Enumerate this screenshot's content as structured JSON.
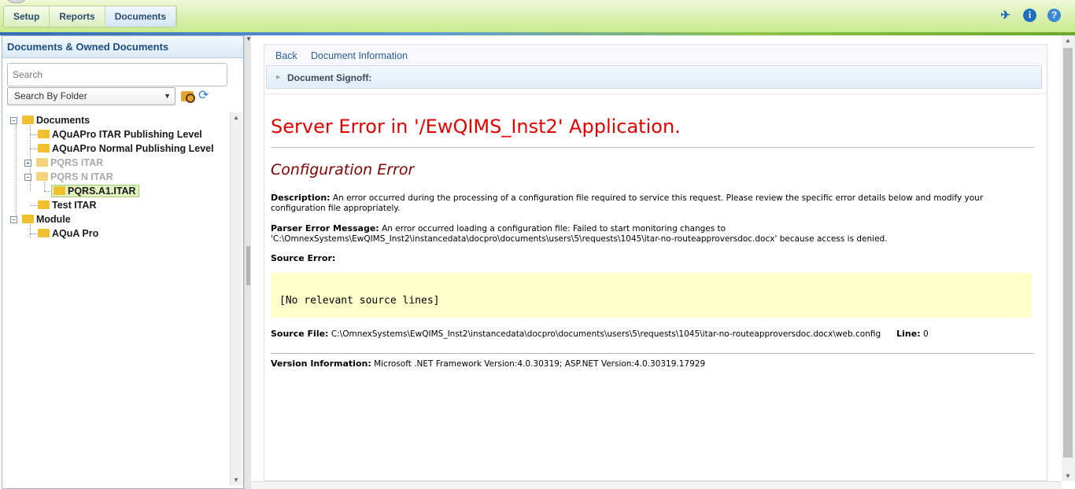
{
  "nav": {
    "tabs": [
      "Setup",
      "Reports",
      "Documents"
    ],
    "active_tab": "Documents"
  },
  "toolbar_icons": [
    "pin-icon",
    "info-icon",
    "help-icon"
  ],
  "left_panel": {
    "title": "Documents & Owned Documents",
    "search_placeholder": "Search",
    "search_mode": "Search By Folder",
    "tree": [
      {
        "label": "Documents",
        "expander": "−"
      },
      {
        "label": "AQuAPro ITAR Publishing Level"
      },
      {
        "label": "AQuAPro Normal Publishing Level"
      },
      {
        "label": "PQRS ITAR",
        "expander": "+"
      },
      {
        "label": "PQRS N ITAR",
        "expander": "−"
      },
      {
        "label": "PQRS.A1.ITAR"
      },
      {
        "label": "Test ITAR"
      },
      {
        "label": "Module",
        "expander": "−"
      },
      {
        "label": "AQuA Pro"
      }
    ]
  },
  "content": {
    "links": [
      "Back",
      "Document Information"
    ],
    "signoff_label": "Document Signoff:",
    "error_title": "Server Error in '/EwQIMS_Inst2' Application.",
    "error_subtitle": "Configuration Error",
    "description_label": "Description:",
    "description_text": "An error occurred during the processing of a configuration file required to service this request. Please review the specific error details below and modify your configuration file appropriately.",
    "parser_label": "Parser Error Message:",
    "parser_text_1": "An error occurred loading a configuration file: Failed to start monitoring changes to",
    "parser_text_2": "'C:\\OmnexSystems\\EwQIMS_Inst2\\instancedata\\docpro\\documents\\users\\5\\requests\\1045\\itar-no-routeapproversdoc.docx' because access is denied.",
    "source_error_label": "Source Error:",
    "source_box_text": "[No relevant source lines]",
    "source_file_label": "Source File:",
    "source_file_path": "C:\\OmnexSystems\\EwQIMS_Inst2\\instancedata\\docpro\\documents\\users\\5\\requests\\1045\\itar-no-routeapproversdoc.docx\\web.config",
    "line_label": "Line:",
    "line_value": "0",
    "version_label": "Version Information:",
    "version_text": "Microsoft .NET Framework Version:4.0.30319; ASP.NET Version:4.0.30319.17929"
  }
}
